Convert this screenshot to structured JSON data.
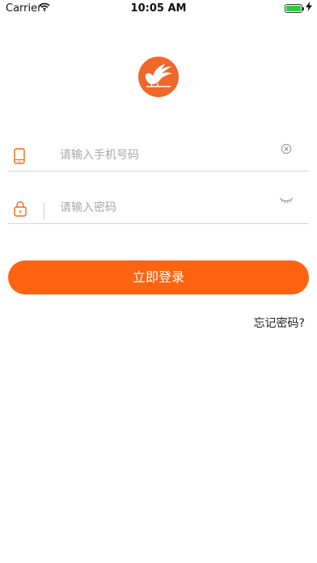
{
  "status_bar": {
    "carrier": "Carrier",
    "time": "10:05 AM",
    "battery_level": 1.0
  },
  "colors": {
    "accent": "#fe6310",
    "icon_orange": "#f26a1b",
    "divider": "#d4d4d4"
  },
  "logo": {
    "icon": "hand-bird-logo"
  },
  "form": {
    "phone": {
      "placeholder": "请输入手机号码",
      "value": "",
      "icon": "phone-icon",
      "clear_icon": "clear-icon"
    },
    "password": {
      "placeholder": "请输入密码",
      "value": "",
      "icon": "lock-icon",
      "visibility_icon": "eye-closed-icon"
    }
  },
  "login_button": {
    "label": "立即登录"
  },
  "forgot_link": {
    "label": "忘记密码?"
  }
}
